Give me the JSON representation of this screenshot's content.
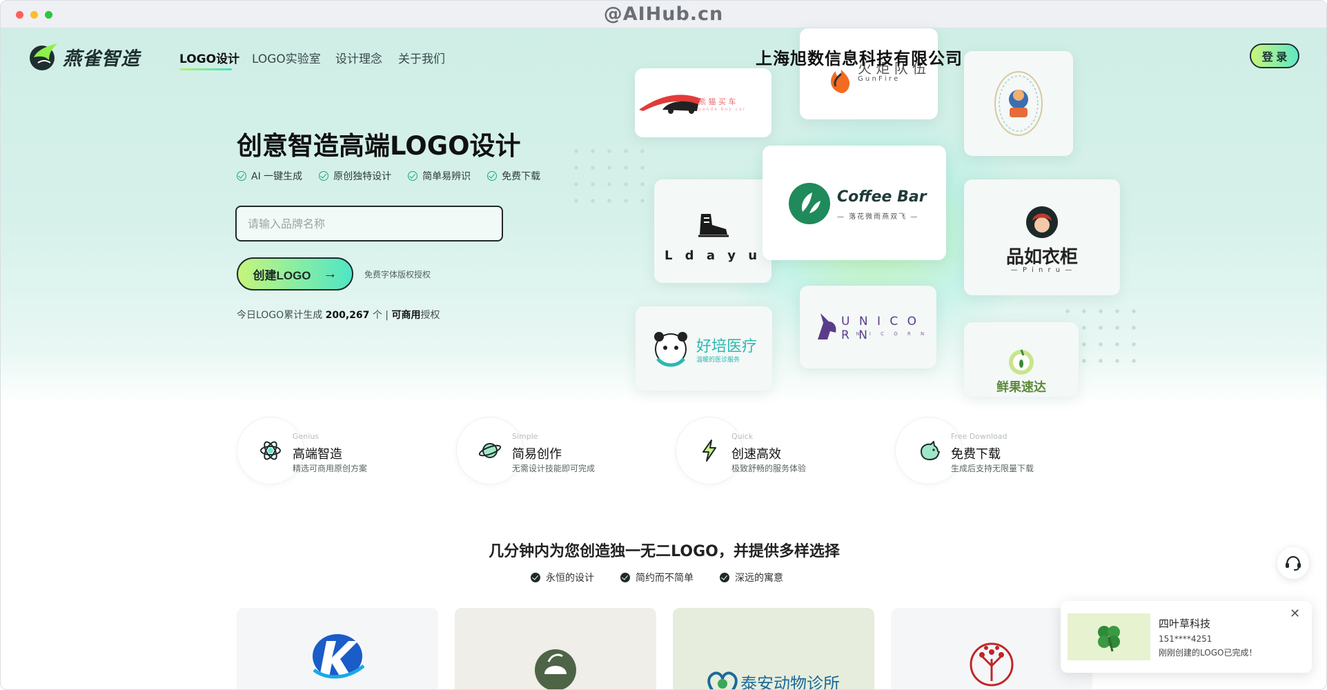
{
  "browser": {
    "watermark": "@AIHub.cn"
  },
  "header": {
    "brand_name": "燕雀智造",
    "nav": [
      "LOGO设计",
      "LOGO实验室",
      "设计理念",
      "关于我们"
    ],
    "company_overlay": "上海旭数信息科技有限公司",
    "login_label": "登 录"
  },
  "hero": {
    "title": "创意智造高端LOGO设计",
    "features": [
      "AI 一键生成",
      "原创独特设计",
      "简单易辨识",
      "免费下载"
    ],
    "input_placeholder": "请输入品牌名称",
    "create_label": "创建LOGO",
    "create_arrow": "→",
    "license_note": "免费字体版权授权",
    "stats": {
      "prefix": "今日LOGO累计生成 ",
      "count": "200,267",
      "suffix": " 个 | ",
      "commercial": "可商用",
      "tail": "授权"
    }
  },
  "showcase": {
    "car_cn": "熊 猫 买 车",
    "car_en": "panda buy car",
    "gunfire_cn": "火 炬 队 伍",
    "gunfire_en": "G u n   F i r e",
    "shoe": "L d a y u",
    "coffee_title": "Coffee Bar",
    "coffee_sub": "— 落花微雨燕双飞 —",
    "pinru_cn": "品如衣柜",
    "pinru_en": "— P i n r u —",
    "haopei_cn": "好培医疗",
    "haopei_sub": "温暖的医诊服务",
    "unicorn": "U N I C O R N",
    "unicorn_small": "U N I C O R N",
    "fruit": "鲜果速达"
  },
  "values": [
    {
      "en": "Genius",
      "title": "高端智造",
      "desc": "精选可商用原创方案"
    },
    {
      "en": "Simple",
      "title": "简易创作",
      "desc": "无需设计技能即可完成"
    },
    {
      "en": "Quick",
      "title": "创速高效",
      "desc": "极致舒畅的服务体验"
    },
    {
      "en": "Free Download",
      "title": "免费下载",
      "desc": "生成后支持无限量下载"
    }
  ],
  "section": {
    "title": "几分钟内为您创造独一无二LOGO，并提供多样选择",
    "points": [
      "永恒的设计",
      "简约而不简单",
      "深远的寓意"
    ]
  },
  "bottom_cards": {
    "clinic_name": "泰安动物诊所"
  },
  "toast": {
    "title": "四叶草科技",
    "phone": "151****4251",
    "message": "刚刚创建的LOGO已完成！",
    "close": "✕"
  },
  "colors": {
    "accent_green": "#1aa870",
    "gradient_start": "#c6f57c",
    "gradient_end": "#4fe6c6",
    "coffee": "#1f8a5b"
  }
}
